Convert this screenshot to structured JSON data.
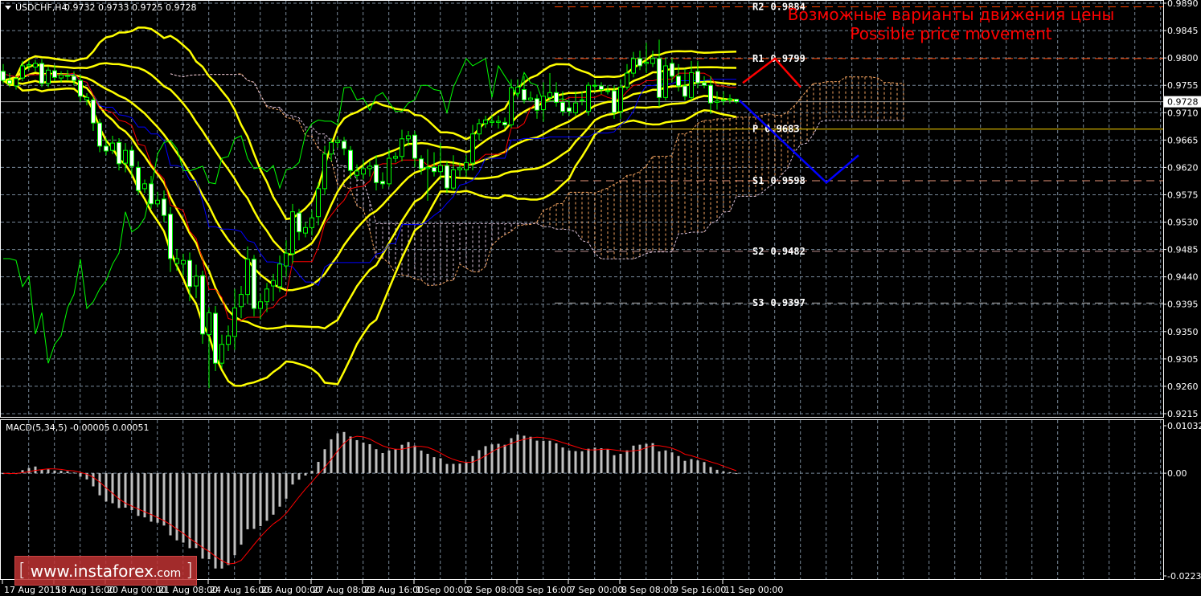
{
  "header": {
    "symbol": "USDCHF,H4",
    "ohlc": "0.9732 0.9733 0.9725 0.9728",
    "menu_icon": "triangle-down-icon"
  },
  "annotation": {
    "title_ru": "Возможные варианты движения цены",
    "title_en": "Possible price movement",
    "color": "#ff0000"
  },
  "watermark": {
    "open": "[",
    "site": "www.instaforex",
    "tld": ".com",
    "close": "]"
  },
  "chart_data": [
    {
      "type": "candlestick",
      "ylim": [
        0.9215,
        0.989
      ],
      "grid": true,
      "price_ticks": [
        "0.9890",
        "0.9845",
        "0.9800",
        "0.9755",
        "0.9710",
        "0.9665",
        "0.9620",
        "0.9575",
        "0.9530",
        "0.9485",
        "0.9440",
        "0.9395",
        "0.9350",
        "0.9305",
        "0.9260",
        "0.9215"
      ],
      "current_price": "0.9728",
      "time_labels": [
        "17 Aug 2015",
        "18 Aug 16:00",
        "20 Aug 00:00",
        "21 Aug 08:00",
        "24 Aug 16:00",
        "26 Aug 00:00",
        "27 Aug 08:00",
        "28 Aug 16:00",
        "1 Sep 00:00",
        "2 Sep 08:00",
        "3 Sep 16:00",
        "7 Sep 00:00",
        "8 Sep 08:00",
        "9 Sep 16:00",
        "11 Sep 00:00"
      ],
      "candles_ohlc": [
        [
          0.9778,
          0.979,
          0.9758,
          0.9763
        ],
        [
          0.9763,
          0.9775,
          0.9752,
          0.9758
        ],
        [
          0.9754,
          0.977,
          0.9748,
          0.9766
        ],
        [
          0.9767,
          0.9795,
          0.9762,
          0.9787
        ],
        [
          0.9787,
          0.9796,
          0.978,
          0.9789
        ],
        [
          0.9785,
          0.9797,
          0.9778,
          0.9791
        ],
        [
          0.9791,
          0.9798,
          0.9752,
          0.9758
        ],
        [
          0.9758,
          0.9786,
          0.9752,
          0.978
        ],
        [
          0.9779,
          0.9788,
          0.9762,
          0.9768
        ],
        [
          0.9767,
          0.9778,
          0.976,
          0.9772
        ],
        [
          0.9771,
          0.978,
          0.9762,
          0.977
        ],
        [
          0.977,
          0.9778,
          0.9755,
          0.9763
        ],
        [
          0.9763,
          0.9772,
          0.9728,
          0.9737
        ],
        [
          0.9731,
          0.9742,
          0.9722,
          0.9735
        ],
        [
          0.9731,
          0.9736,
          0.968,
          0.9693
        ],
        [
          0.9693,
          0.97,
          0.9645,
          0.9655
        ],
        [
          0.9655,
          0.9668,
          0.964,
          0.9647
        ],
        [
          0.9648,
          0.9672,
          0.9642,
          0.966
        ],
        [
          0.9661,
          0.9668,
          0.9615,
          0.9626
        ],
        [
          0.9627,
          0.966,
          0.9612,
          0.9648
        ],
        [
          0.9648,
          0.9656,
          0.9605,
          0.9622
        ],
        [
          0.962,
          0.963,
          0.9575,
          0.9582
        ],
        [
          0.9585,
          0.96,
          0.9578,
          0.9593
        ],
        [
          0.9593,
          0.9606,
          0.9552,
          0.956
        ],
        [
          0.956,
          0.958,
          0.9554,
          0.9566
        ],
        [
          0.9568,
          0.9582,
          0.953,
          0.9541
        ],
        [
          0.9543,
          0.9555,
          0.9448,
          0.947
        ],
        [
          0.9462,
          0.9486,
          0.945,
          0.947
        ],
        [
          0.9461,
          0.9478,
          0.9442,
          0.9467
        ],
        [
          0.9467,
          0.948,
          0.94,
          0.9424
        ],
        [
          0.9425,
          0.946,
          0.9405,
          0.9441
        ],
        [
          0.9442,
          0.945,
          0.933,
          0.9346
        ],
        [
          0.9345,
          0.939,
          0.9257,
          0.9381
        ],
        [
          0.938,
          0.9392,
          0.9285,
          0.9298
        ],
        [
          0.9298,
          0.9345,
          0.929,
          0.9329
        ],
        [
          0.9329,
          0.936,
          0.9318,
          0.9343
        ],
        [
          0.9342,
          0.942,
          0.932,
          0.9389
        ],
        [
          0.9391,
          0.9425,
          0.9372,
          0.9411
        ],
        [
          0.9411,
          0.949,
          0.9395,
          0.9469
        ],
        [
          0.9469,
          0.9476,
          0.9375,
          0.9388
        ],
        [
          0.9388,
          0.9412,
          0.937,
          0.9399
        ],
        [
          0.9399,
          0.943,
          0.9382,
          0.942
        ],
        [
          0.9425,
          0.9445,
          0.94,
          0.9434
        ],
        [
          0.9424,
          0.9475,
          0.9415,
          0.9461
        ],
        [
          0.9458,
          0.95,
          0.944,
          0.9479
        ],
        [
          0.9478,
          0.956,
          0.9462,
          0.9547
        ],
        [
          0.9545,
          0.9552,
          0.95,
          0.9514
        ],
        [
          0.9512,
          0.953,
          0.9505,
          0.9521
        ],
        [
          0.9521,
          0.955,
          0.9508,
          0.9537
        ],
        [
          0.9539,
          0.9595,
          0.9525,
          0.9585
        ],
        [
          0.9585,
          0.9655,
          0.9575,
          0.9642
        ],
        [
          0.9642,
          0.9668,
          0.963,
          0.9661
        ],
        [
          0.9661,
          0.967,
          0.9652,
          0.9664
        ],
        [
          0.9663,
          0.967,
          0.964,
          0.9651
        ],
        [
          0.9648,
          0.9655,
          0.9602,
          0.9615
        ],
        [
          0.9607,
          0.9625,
          0.96,
          0.9614
        ],
        [
          0.9609,
          0.9632,
          0.96,
          0.9618
        ],
        [
          0.9618,
          0.963,
          0.9605,
          0.9622
        ],
        [
          0.9624,
          0.964,
          0.9582,
          0.9595
        ],
        [
          0.9597,
          0.9612,
          0.9585,
          0.9593
        ],
        [
          0.9593,
          0.965,
          0.9588,
          0.9635
        ],
        [
          0.9635,
          0.9645,
          0.9628,
          0.9638
        ],
        [
          0.9638,
          0.9682,
          0.963,
          0.9667
        ],
        [
          0.9667,
          0.968,
          0.9655,
          0.9672
        ],
        [
          0.9673,
          0.968,
          0.962,
          0.9635
        ],
        [
          0.9634,
          0.964,
          0.9608,
          0.9618
        ],
        [
          0.9618,
          0.965,
          0.9565,
          0.962
        ],
        [
          0.962,
          0.9645,
          0.9605,
          0.9613
        ],
        [
          0.9613,
          0.966,
          0.96,
          0.9623
        ],
        [
          0.9623,
          0.963,
          0.9578,
          0.9586
        ],
        [
          0.9586,
          0.964,
          0.9582,
          0.9616
        ],
        [
          0.9616,
          0.9628,
          0.9605,
          0.9619
        ],
        [
          0.9616,
          0.964,
          0.9605,
          0.9628
        ],
        [
          0.9627,
          0.969,
          0.9615,
          0.9675
        ],
        [
          0.9675,
          0.97,
          0.9665,
          0.9692
        ],
        [
          0.9692,
          0.9705,
          0.9685,
          0.9698
        ],
        [
          0.9694,
          0.9705,
          0.9688,
          0.9696
        ],
        [
          0.9694,
          0.9705,
          0.9684,
          0.9696
        ],
        [
          0.9694,
          0.9702,
          0.9684,
          0.969
        ],
        [
          0.969,
          0.9765,
          0.9685,
          0.9751
        ],
        [
          0.9742,
          0.9765,
          0.9735,
          0.9752
        ],
        [
          0.9748,
          0.977,
          0.9725,
          0.9731
        ],
        [
          0.9731,
          0.9745,
          0.9728,
          0.9734
        ],
        [
          0.9733,
          0.974,
          0.97,
          0.9714
        ],
        [
          0.9715,
          0.976,
          0.9695,
          0.9737
        ],
        [
          0.9735,
          0.9775,
          0.973,
          0.9743
        ],
        [
          0.9743,
          0.976,
          0.972,
          0.9727
        ],
        [
          0.9727,
          0.9745,
          0.9705,
          0.9712
        ],
        [
          0.9718,
          0.973,
          0.9705,
          0.9712
        ],
        [
          0.971,
          0.9745,
          0.9705,
          0.9726
        ],
        [
          0.973,
          0.9745,
          0.9722,
          0.9731
        ],
        [
          0.9712,
          0.976,
          0.9705,
          0.9755
        ],
        [
          0.9754,
          0.9765,
          0.9745,
          0.9755
        ],
        [
          0.9754,
          0.976,
          0.974,
          0.9748
        ],
        [
          0.9746,
          0.9755,
          0.974,
          0.9746
        ],
        [
          0.9746,
          0.9755,
          0.97,
          0.971
        ],
        [
          0.9712,
          0.9765,
          0.97,
          0.9752
        ],
        [
          0.9752,
          0.979,
          0.9748,
          0.9775
        ],
        [
          0.9775,
          0.981,
          0.9768,
          0.9799
        ],
        [
          0.9799,
          0.9812,
          0.978,
          0.9787
        ],
        [
          0.9791,
          0.9825,
          0.9775,
          0.9793
        ],
        [
          0.9791,
          0.9812,
          0.9785,
          0.9799
        ],
        [
          0.9799,
          0.983,
          0.972,
          0.9735
        ],
        [
          0.9735,
          0.98,
          0.973,
          0.9787
        ],
        [
          0.9791,
          0.98,
          0.976,
          0.977
        ],
        [
          0.977,
          0.979,
          0.9745,
          0.9754
        ],
        [
          0.9754,
          0.9782,
          0.973,
          0.9737
        ],
        [
          0.9735,
          0.9795,
          0.973,
          0.9776
        ],
        [
          0.9778,
          0.9795,
          0.975,
          0.9759
        ],
        [
          0.9759,
          0.977,
          0.975,
          0.9755
        ],
        [
          0.9755,
          0.977,
          0.9708,
          0.9726
        ],
        [
          0.9727,
          0.9745,
          0.9715,
          0.9729
        ],
        [
          0.9731,
          0.9745,
          0.9722,
          0.9731
        ],
        [
          0.9731,
          0.974,
          0.9725,
          0.9733
        ],
        [
          0.9732,
          0.9733,
          0.9725,
          0.9728
        ]
      ],
      "pivots": [
        {
          "label": "R2",
          "value": "0.9884",
          "color": "#ff4500"
        },
        {
          "label": "R1",
          "value": "0.9799",
          "color": "#ff4500"
        },
        {
          "label": "P",
          "value": "0.9683",
          "color": "#ffd700"
        },
        {
          "label": "S1",
          "value": "0.9598",
          "color": "#e9967a"
        },
        {
          "label": "S2",
          "value": "0.9482",
          "color": "#bc8f8f"
        },
        {
          "label": "S3",
          "value": "0.9397",
          "color": "#a9a9a9"
        }
      ],
      "projections": [
        {
          "color": "#ff0000",
          "points_bars_ahead_price": [
            [
              1,
              0.9759
            ],
            [
              6,
              0.9799
            ],
            [
              10,
              0.9752
            ]
          ]
        },
        {
          "color": "#0000ff",
          "points_bars_ahead_price": [
            [
              0.5,
              0.973
            ],
            [
              14,
              0.9595
            ],
            [
              19,
              0.964
            ]
          ]
        }
      ],
      "colors": {
        "bull_fill": "#000000",
        "bear_fill": "#ffffff",
        "candle_outline": "#00ff00",
        "bands": "#ffff00",
        "tenkan": "#ff0000",
        "kijun": "#0000ff",
        "chikou": "#00ff00",
        "span_a": "#f4a460",
        "span_b": "#d8bfd8",
        "grid": "#778899"
      }
    },
    {
      "type": "bar",
      "title": "MACD(5,34,5) -0.00005 0.00051",
      "ylim": [
        -0.02233,
        0.01032
      ],
      "ticks": [
        "0.01032",
        "0.00",
        "-0.02233"
      ],
      "colors": {
        "histogram": "#c0c0c0",
        "signal": "#ff0000"
      }
    }
  ]
}
